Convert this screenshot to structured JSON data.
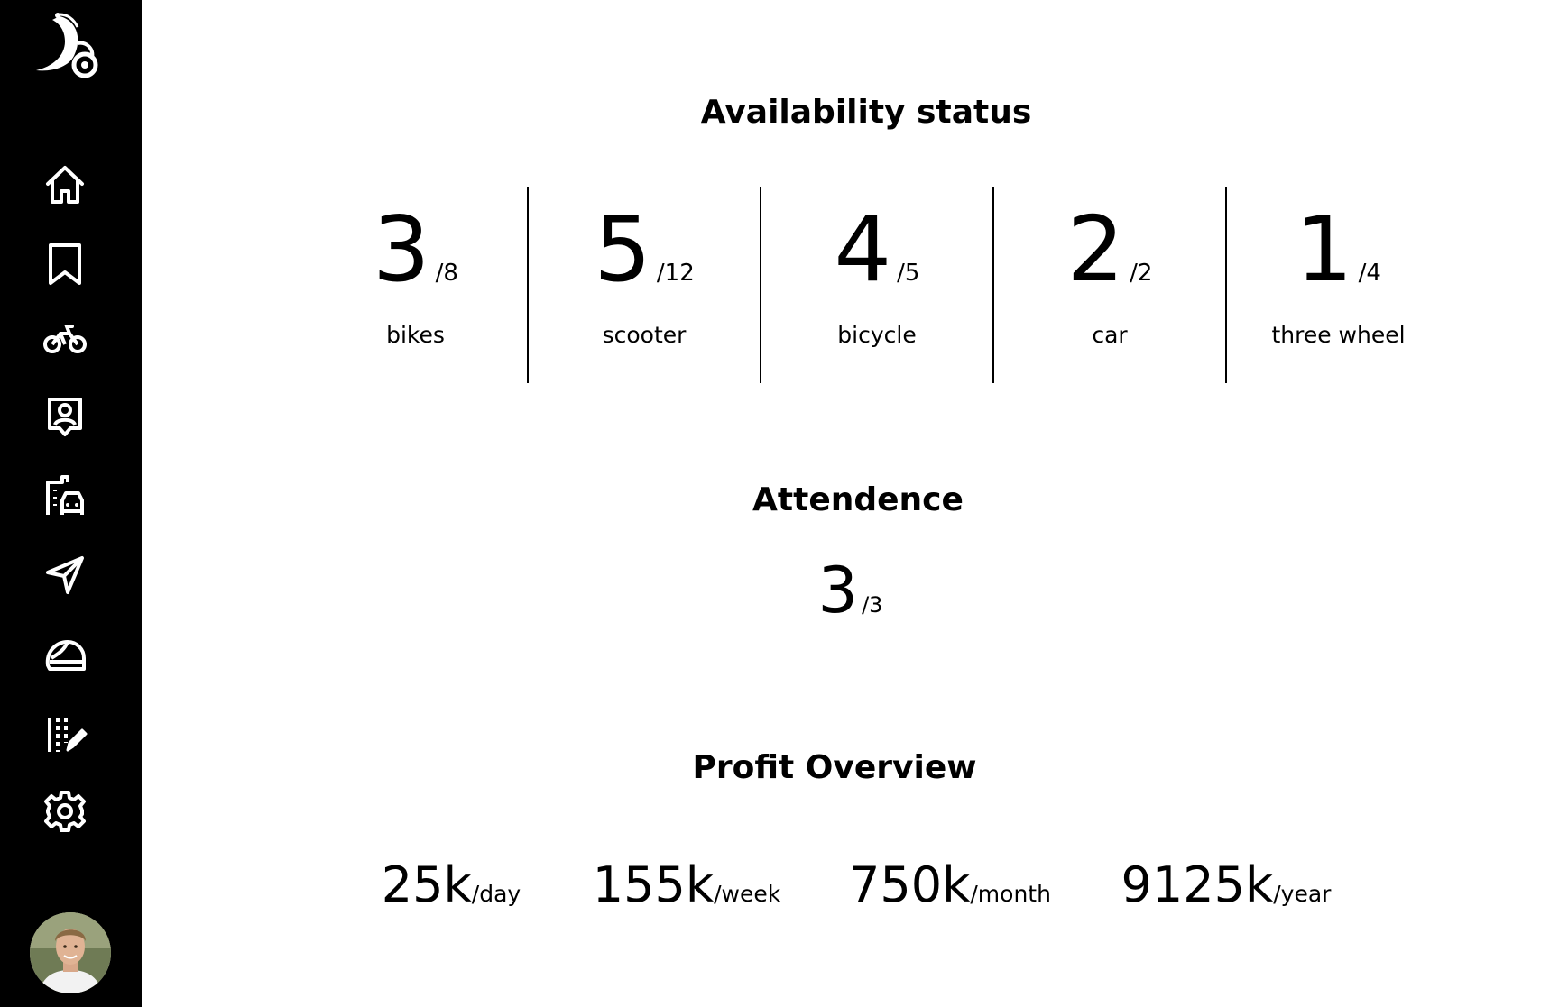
{
  "sidebar": {
    "logo_icon": "rider-moon-logo-icon",
    "nav": [
      {
        "icon": "home-icon"
      },
      {
        "icon": "bookmark-icon"
      },
      {
        "icon": "motorbike-icon"
      },
      {
        "icon": "user-badge-icon"
      },
      {
        "icon": "building-car-icon"
      },
      {
        "icon": "send-icon"
      },
      {
        "icon": "helmet-icon"
      },
      {
        "icon": "edit-list-icon"
      },
      {
        "icon": "gear-icon"
      }
    ],
    "avatar_icon": "user-avatar"
  },
  "availability": {
    "title": "Availability status",
    "items": [
      {
        "value": "3",
        "total": "/8",
        "label": "bikes"
      },
      {
        "value": "5",
        "total": "/12",
        "label": "scooter"
      },
      {
        "value": "4",
        "total": "/5",
        "label": "bicycle"
      },
      {
        "value": "2",
        "total": "/2",
        "label": "car"
      },
      {
        "value": "1",
        "total": "/4",
        "label": "three wheel"
      }
    ]
  },
  "attendance": {
    "title": "Attendence",
    "value": "3",
    "total": "/3"
  },
  "profit": {
    "title": "Profit Overview",
    "items": [
      {
        "value": "25k",
        "unit": "/day"
      },
      {
        "value": "155k",
        "unit": "/week"
      },
      {
        "value": "750k",
        "unit": "/month"
      },
      {
        "value": "9125k",
        "unit": "/year"
      }
    ]
  },
  "colors": {
    "sidebar_bg": "#000000",
    "icon": "#ffffff",
    "text": "#000000",
    "background": "#ffffff"
  }
}
